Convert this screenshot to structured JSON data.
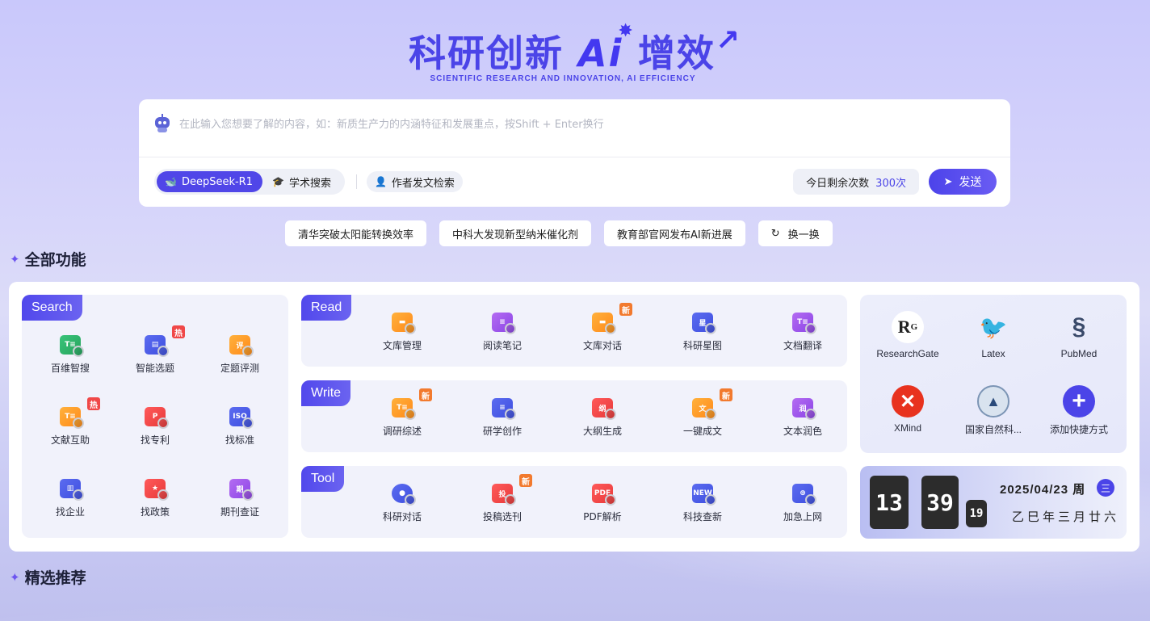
{
  "hero": {
    "title_cn": "科研创新",
    "title_ai": "Ai",
    "title_cn2": "增效",
    "subtitle": "SCIENTIFIC RESEARCH AND INNOVATION, AI EFFICIENCY"
  },
  "search": {
    "placeholder": "在此输入您想要了解的内容，如：新质生产力的内涵特征和发展重点，按Shift + Enter换行",
    "model_label": "DeepSeek-R1",
    "academic_label": "学术搜索",
    "author_label": "作者发文检索",
    "quota_label": "今日剩余次数",
    "quota_value": "300次",
    "send_label": "发送"
  },
  "chips": {
    "items": [
      "清华突破太阳能转换效率",
      "中科大发现新型纳米催化剂",
      "教育部官网发布AI新进展"
    ],
    "refresh_label": "换一换"
  },
  "sections": {
    "all_features": "全部功能",
    "featured": "精选推荐"
  },
  "search_card": {
    "tag": "Search",
    "items": [
      {
        "label": "百维智搜",
        "icon": "document-search-icon",
        "color": "#39c47a"
      },
      {
        "label": "智能选题",
        "icon": "topic-icon",
        "color": "#5b6cf0",
        "badge": "热"
      },
      {
        "label": "定题评测",
        "icon": "evaluation-icon",
        "color": "#ffb13c"
      },
      {
        "label": "文献互助",
        "icon": "literature-icon",
        "color": "#ffb13c",
        "badge": "热"
      },
      {
        "label": "找专利",
        "icon": "patent-icon",
        "color": "#ff5a5a"
      },
      {
        "label": "找标准",
        "icon": "standard-icon",
        "color": "#5b6cf0"
      },
      {
        "label": "找企业",
        "icon": "company-icon",
        "color": "#5b6cf0"
      },
      {
        "label": "找政策",
        "icon": "policy-icon",
        "color": "#ff5a5a"
      },
      {
        "label": "期刊查证",
        "icon": "journal-icon",
        "color": "#b46cf2"
      }
    ]
  },
  "read_card": {
    "tag": "Read",
    "items": [
      {
        "label": "文库管理",
        "icon": "folder-icon"
      },
      {
        "label": "阅读笔记",
        "icon": "note-icon"
      },
      {
        "label": "文库对话",
        "icon": "folder-chat-icon",
        "badge": "新"
      },
      {
        "label": "科研星图",
        "icon": "star-map-icon"
      },
      {
        "label": "文档翻译",
        "icon": "translate-icon"
      }
    ]
  },
  "write_card": {
    "tag": "Write",
    "items": [
      {
        "label": "调研综述",
        "icon": "review-icon",
        "badge": "新"
      },
      {
        "label": "研学创作",
        "icon": "writing-icon"
      },
      {
        "label": "大纲生成",
        "icon": "outline-icon"
      },
      {
        "label": "一键成文",
        "icon": "one-click-icon",
        "badge": "新"
      },
      {
        "label": "文本润色",
        "icon": "polish-icon"
      }
    ]
  },
  "tool_card": {
    "tag": "Tool",
    "items": [
      {
        "label": "科研对话",
        "icon": "chat-icon"
      },
      {
        "label": "投稿选刊",
        "icon": "submission-icon",
        "badge": "新"
      },
      {
        "label": "PDF解析",
        "icon": "pdf-icon"
      },
      {
        "label": "科技查新",
        "icon": "novelty-icon"
      },
      {
        "label": "加急上网",
        "icon": "globe-icon"
      }
    ]
  },
  "shortcuts": {
    "items": [
      {
        "label": "ResearchGate",
        "icon": "researchgate-icon"
      },
      {
        "label": "Latex",
        "icon": "latex-icon"
      },
      {
        "label": "PubMed",
        "icon": "pubmed-icon"
      },
      {
        "label": "XMind",
        "icon": "xmind-icon"
      },
      {
        "label": "国家自然科...",
        "icon": "nsfc-icon"
      },
      {
        "label": "添加快捷方式",
        "icon": "add-icon"
      }
    ]
  },
  "clock": {
    "hour": "13",
    "minute": "39",
    "second": "19",
    "date": "2025/04/23 周",
    "weekday": "三",
    "lunar": "乙巳年三月廿六"
  }
}
